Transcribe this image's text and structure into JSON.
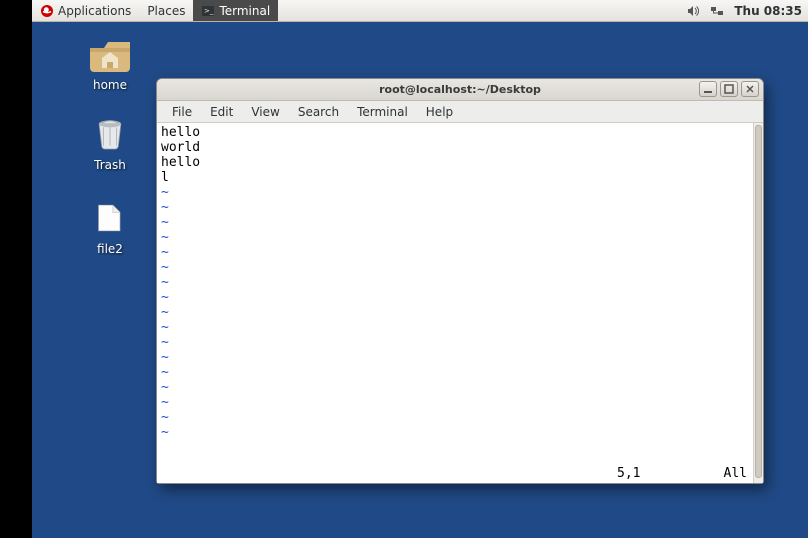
{
  "panel": {
    "applications": "Applications",
    "places": "Places",
    "taskbar_app": "Terminal",
    "clock": "Thu 08:35"
  },
  "desktop": {
    "home": "home",
    "trash": "Trash",
    "file2": "file2"
  },
  "window": {
    "title": "root@localhost:~/Desktop",
    "menus": {
      "file": "File",
      "edit": "Edit",
      "view": "View",
      "search": "Search",
      "terminal": "Terminal",
      "help": "Help"
    },
    "content_lines": {
      "l1": "hello",
      "l2": "world",
      "l3": "",
      "l4": "hello",
      "l5": "l"
    },
    "tilde": "~",
    "status": {
      "pos": "5,1",
      "scope": "All"
    }
  }
}
